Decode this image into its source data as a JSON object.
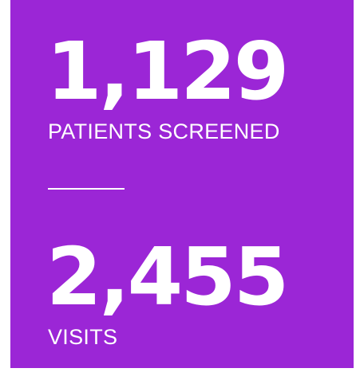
{
  "colors": {
    "panel_background": "#9b26d6",
    "text": "#ffffff",
    "page_background": "#ffffff"
  },
  "stats": [
    {
      "value": "1,129",
      "label": "PATIENTS SCREENED"
    },
    {
      "value": "2,455",
      "label": "VISITS"
    }
  ]
}
